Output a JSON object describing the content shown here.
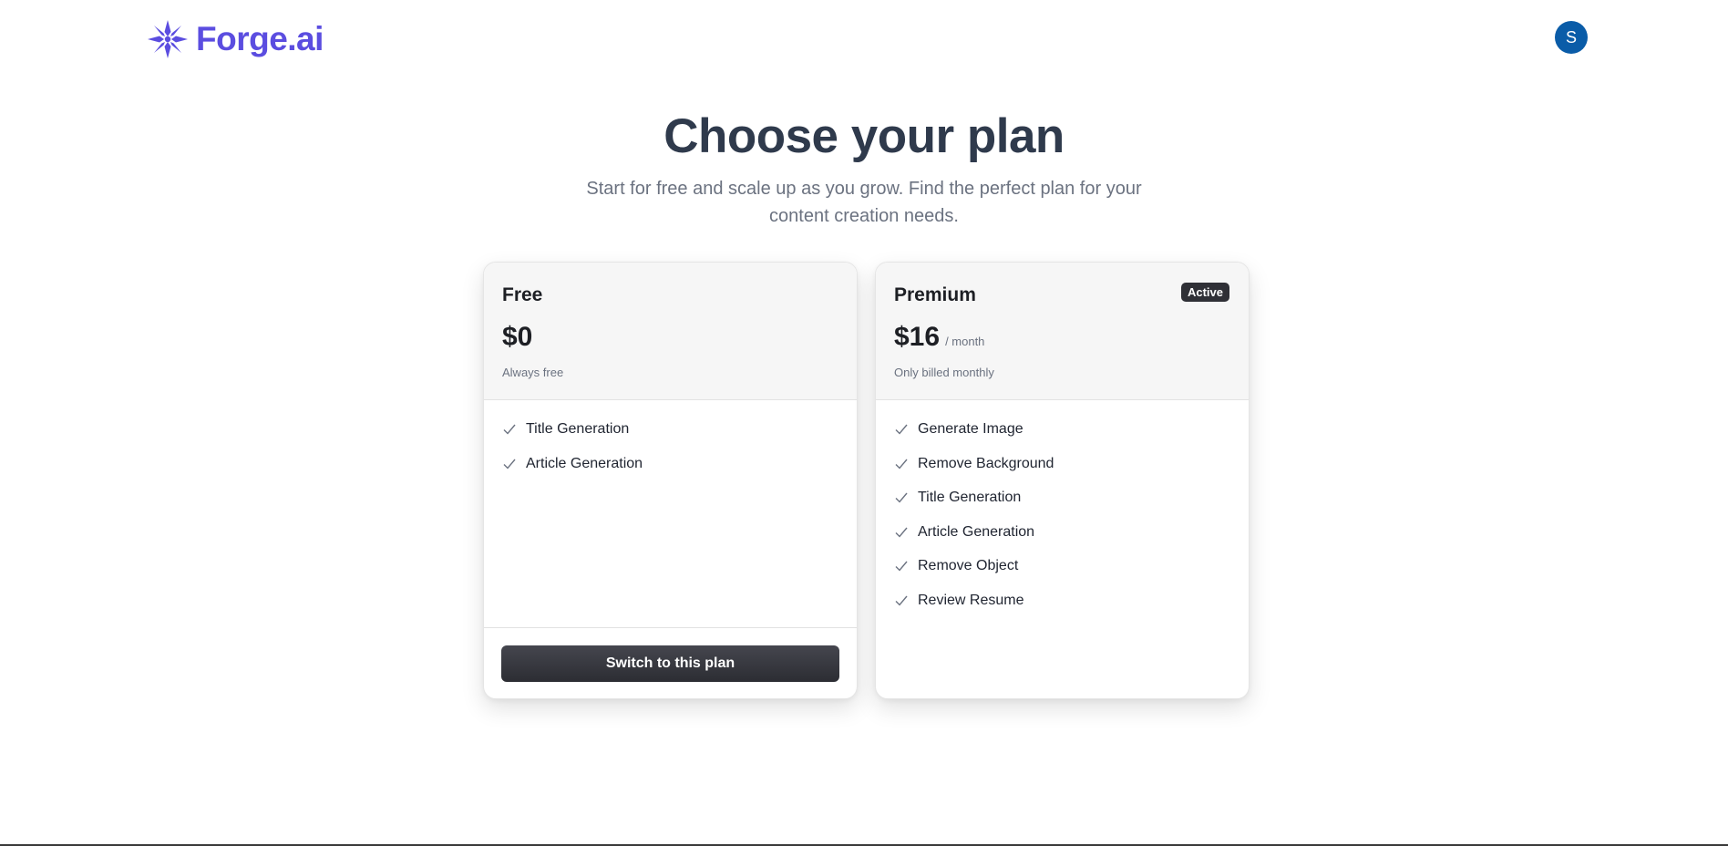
{
  "brand": {
    "name": "Forge.ai",
    "color": "#5b4de0",
    "icon": "snowflake-star-icon"
  },
  "user": {
    "avatar_initial": "S",
    "avatar_color": "#0a5ca8"
  },
  "hero": {
    "title": "Choose your plan",
    "subtitle": "Start for free and scale up as you grow. Find the perfect plan for your content creation needs."
  },
  "plans": [
    {
      "name": "Free",
      "price": "$0",
      "period": "",
      "note": "Always free",
      "features": [
        "Title Generation",
        "Article Generation"
      ],
      "button_label": "Switch to this plan"
    },
    {
      "name": "Premium",
      "price": "$16",
      "period": "/ month",
      "note": "Only billed monthly",
      "badge": "Active",
      "features": [
        "Generate Image",
        "Remove Background",
        "Title Generation",
        "Article Generation",
        "Remove Object",
        "Review Resume"
      ]
    }
  ]
}
